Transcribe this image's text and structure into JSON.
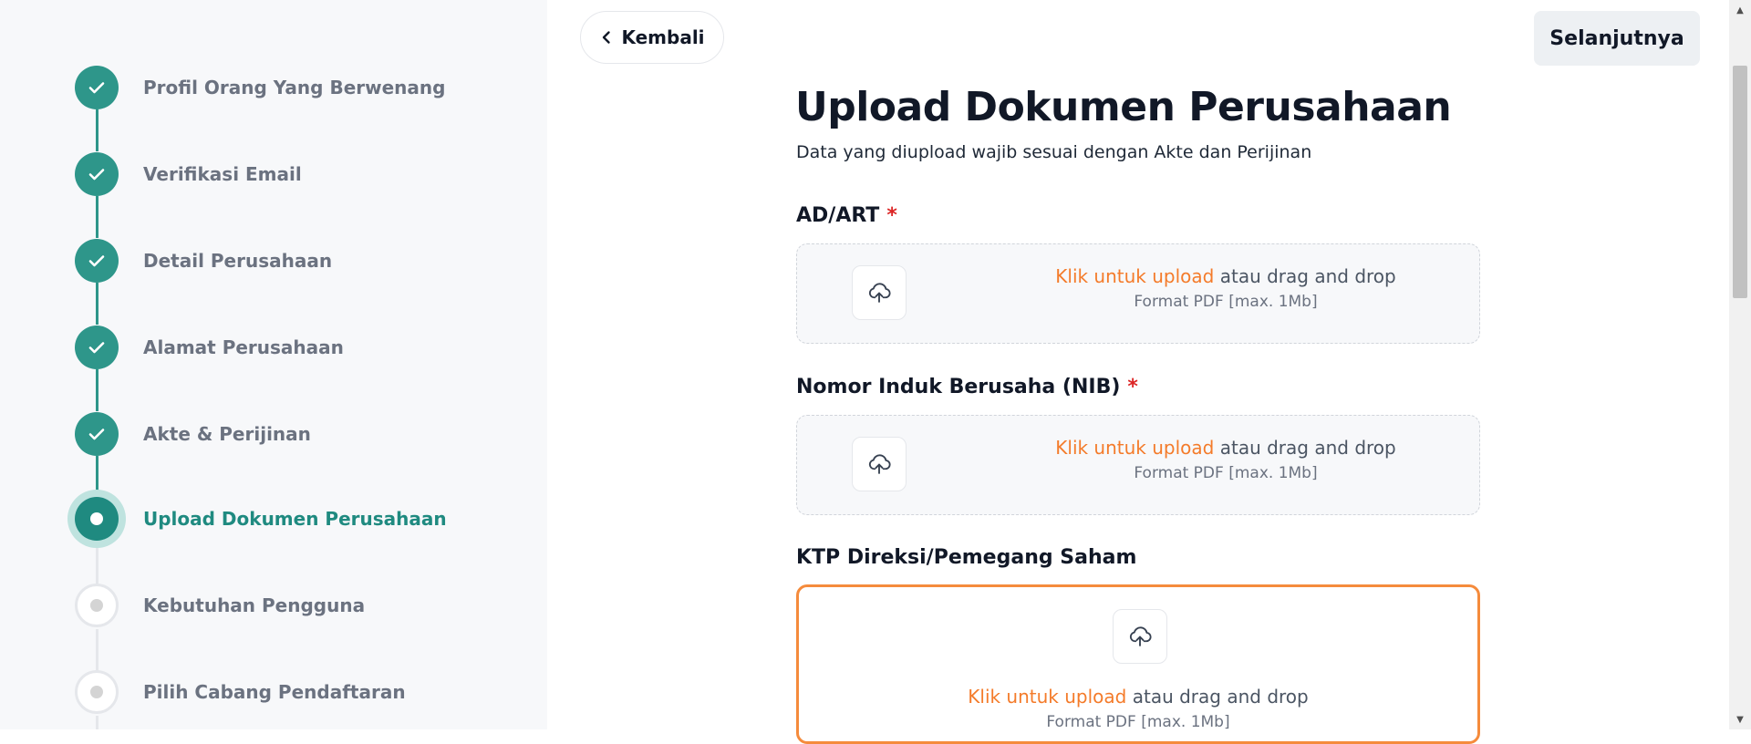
{
  "sidebar": {
    "steps": [
      {
        "label": "Profil Orang Yang Berwenang",
        "status": "done"
      },
      {
        "label": "Verifikasi Email",
        "status": "done"
      },
      {
        "label": "Detail Perusahaan",
        "status": "done"
      },
      {
        "label": "Alamat Perusahaan",
        "status": "done"
      },
      {
        "label": "Akte & Perijinan",
        "status": "done"
      },
      {
        "label": "Upload Dokumen Perusahaan",
        "status": "active"
      },
      {
        "label": "Kebutuhan Pengguna",
        "status": "pending"
      },
      {
        "label": "Pilih Cabang Pendaftaran",
        "status": "pending"
      }
    ]
  },
  "header": {
    "back_label": "Kembali",
    "next_label": "Selanjutnya"
  },
  "main": {
    "title": "Upload Dokumen Perusahaan",
    "subtitle": "Data yang diupload wajib sesuai dengan Akte dan Perijinan",
    "fields": [
      {
        "label": "AD/ART",
        "required_mark": "*",
        "link_text": "Klik untuk upload",
        "rest_text": " atau drag and drop",
        "hint": "Format PDF [max. 1Mb]"
      },
      {
        "label": "Nomor Induk Berusaha (NIB)",
        "required_mark": "*",
        "link_text": "Klik untuk upload",
        "rest_text": " atau drag and drop",
        "hint": "Format PDF [max. 1Mb]"
      },
      {
        "label": "KTP Direksi/Pemegang Saham",
        "link_text": "Klik untuk upload",
        "rest_text": " atau drag and drop",
        "hint": "Format PDF [max. 1Mb]"
      }
    ]
  },
  "colors": {
    "accent_teal": "#2e968a",
    "link_orange": "#f47b2a",
    "focus_border": "#f58b3c",
    "required_red": "#dc2626"
  },
  "icons": {
    "done": "check-icon",
    "upload": "cloud-upload-icon",
    "back": "chevron-left-icon"
  }
}
